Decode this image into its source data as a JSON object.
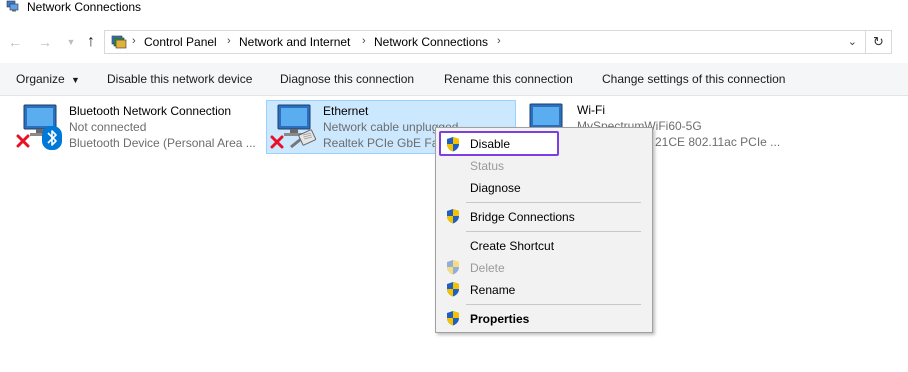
{
  "window": {
    "title": "Network Connections"
  },
  "address_bar": {
    "crumbs": [
      "Control Panel",
      "Network and Internet",
      "Network Connections"
    ]
  },
  "toolbar": {
    "organize": "Organize",
    "disable_device": "Disable this network device",
    "diagnose": "Diagnose this connection",
    "rename": "Rename this connection",
    "change_settings": "Change settings of this connection"
  },
  "connections": [
    {
      "name": "Bluetooth Network Connection",
      "status": "Not connected",
      "device": "Bluetooth Device (Personal Area ..."
    },
    {
      "name": "Ethernet",
      "status": "Network cable unplugged",
      "device": "Realtek PCIe GbE Fam"
    },
    {
      "name": "Wi-Fi",
      "status": "MySpectrumWiFi60-5G",
      "device": "21CE 802.11ac PCIe ..."
    }
  ],
  "context_menu": {
    "items": [
      {
        "label": "Disable",
        "enabled": true,
        "shield": true
      },
      {
        "label": "Status",
        "enabled": false,
        "shield": false
      },
      {
        "label": "Diagnose",
        "enabled": true,
        "shield": false
      },
      {
        "label": "Bridge Connections",
        "enabled": true,
        "shield": true
      },
      {
        "label": "Create Shortcut",
        "enabled": true,
        "shield": false
      },
      {
        "label": "Delete",
        "enabled": false,
        "shield": true
      },
      {
        "label": "Rename",
        "enabled": true,
        "shield": true
      },
      {
        "label": "Properties",
        "enabled": true,
        "shield": true,
        "bold": true
      }
    ]
  },
  "colors": {
    "selection_fill": "#cce8ff",
    "selection_border": "#99d1ff",
    "highlight_outline": "#7b3fe4",
    "error_x": "#e81123",
    "bluetooth_blue": "#0078d7"
  }
}
